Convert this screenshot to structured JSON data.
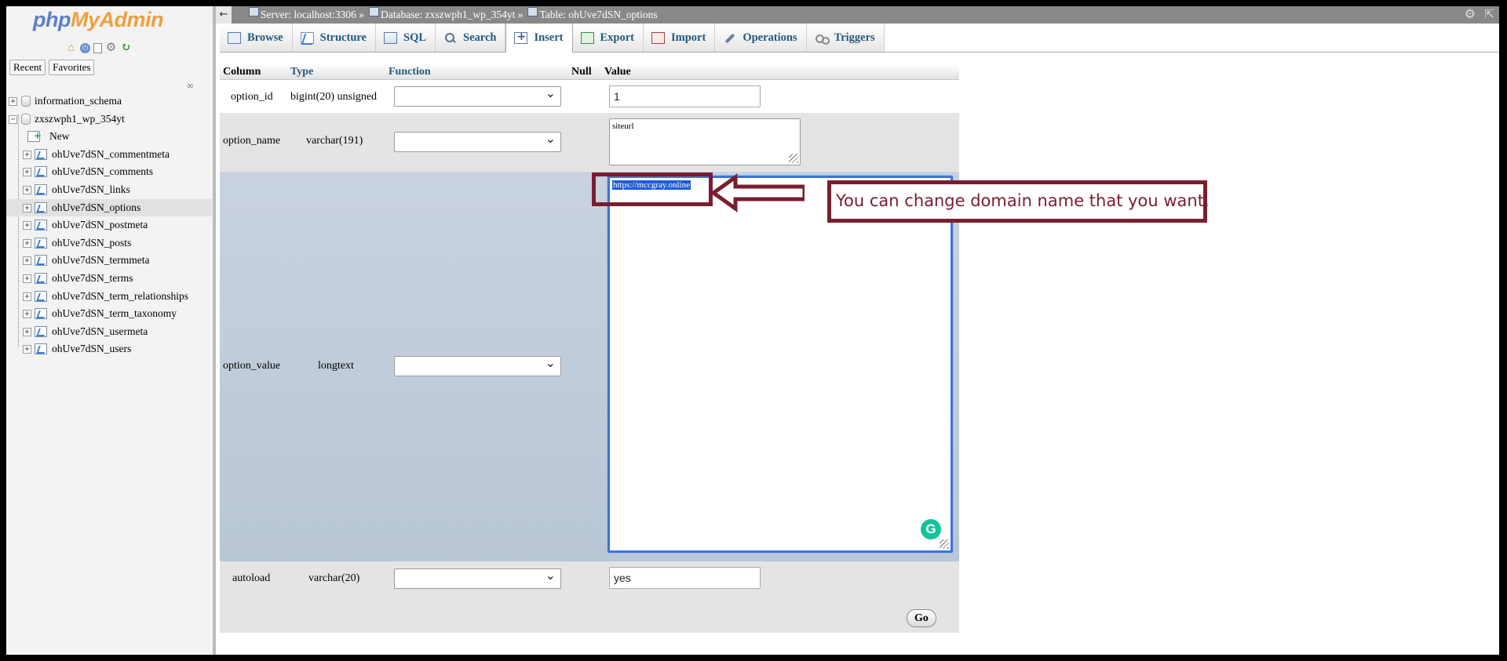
{
  "app": {
    "logo_php": "php",
    "logo_myadmin": "MyAdmin",
    "nav_tabs": [
      "Recent",
      "Favorites"
    ]
  },
  "tree": {
    "databases": [
      "information_schema",
      "zxszwph1_wp_354yt"
    ],
    "new_label": "New",
    "tables": [
      "ohUve7dSN_commentmeta",
      "ohUve7dSN_comments",
      "ohUve7dSN_links",
      "ohUve7dSN_options",
      "ohUve7dSN_postmeta",
      "ohUve7dSN_posts",
      "ohUve7dSN_termmeta",
      "ohUve7dSN_terms",
      "ohUve7dSN_term_relationships",
      "ohUve7dSN_term_taxonomy",
      "ohUve7dSN_usermeta",
      "ohUve7dSN_users"
    ],
    "active_table_index": 3
  },
  "breadcrumb": {
    "server": "Server: localhost:3306 »",
    "database": "Database: zxszwph1_wp_354yt »",
    "table": "Table: ohUve7dSN_options"
  },
  "tabs": [
    {
      "label": "Browse",
      "icon": "browse-icon"
    },
    {
      "label": "Structure",
      "icon": "structure-icon"
    },
    {
      "label": "SQL",
      "icon": "sql-icon"
    },
    {
      "label": "Search",
      "icon": "search-icon"
    },
    {
      "label": "Insert",
      "icon": "insert-icon",
      "active": true
    },
    {
      "label": "Export",
      "icon": "export-icon"
    },
    {
      "label": "Import",
      "icon": "import-icon"
    },
    {
      "label": "Operations",
      "icon": "wrench-icon"
    },
    {
      "label": "Triggers",
      "icon": "triggers-icon"
    }
  ],
  "form": {
    "headers": {
      "column": "Column",
      "type": "Type",
      "function": "Function",
      "null": "Null",
      "value": "Value"
    },
    "rows": [
      {
        "column": "option_id",
        "type": "bigint(20) unsigned",
        "function": "",
        "value": "1"
      },
      {
        "column": "option_name",
        "type": "varchar(191)",
        "function": "",
        "value": "siteurl"
      },
      {
        "column": "option_value",
        "type": "longtext",
        "function": "",
        "value": "https://mccgray.online"
      },
      {
        "column": "autoload",
        "type": "varchar(20)",
        "function": "",
        "value": "yes"
      }
    ],
    "go_label": "Go"
  },
  "annotation": {
    "note": "You can change domain name that you want.",
    "color": "#7a1d2f"
  },
  "colors": {
    "row_light": "#e4e4e4",
    "row_blue": "#c6d0dd",
    "link": "#235a81",
    "topbar": "#888888"
  }
}
